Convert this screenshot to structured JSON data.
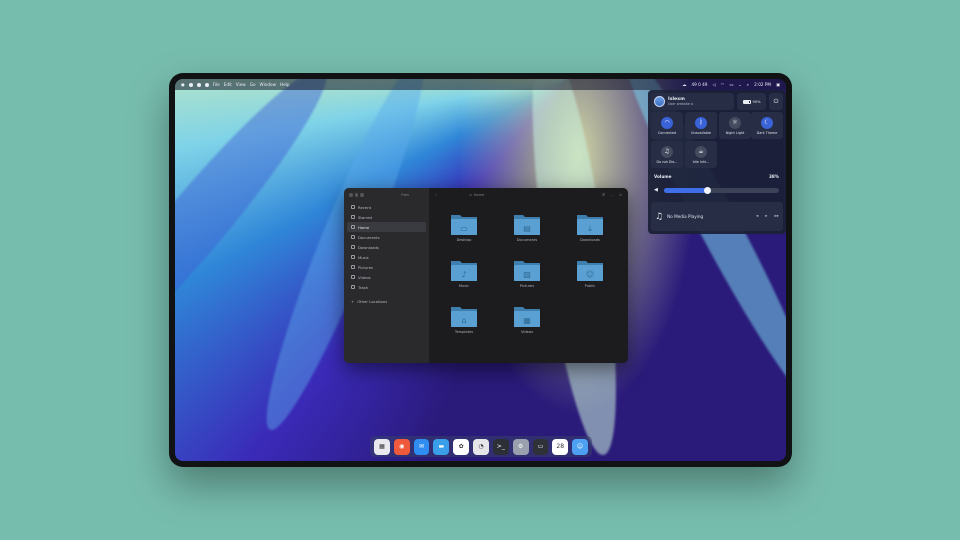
{
  "menubar": {
    "apple_icon": "apple-icon",
    "menus": [
      "File",
      "Edit",
      "View",
      "Go",
      "Window",
      "Help"
    ],
    "clock": "2:02 PM",
    "status_text": "49 0 49"
  },
  "file_manager": {
    "sidebar_title": "Files",
    "path_label": "Home",
    "sidebar_items": [
      {
        "label": "Recent",
        "icon": "clock-icon"
      },
      {
        "label": "Starred",
        "icon": "star-icon"
      },
      {
        "label": "Home",
        "icon": "home-icon"
      },
      {
        "label": "Documents",
        "icon": "document-icon"
      },
      {
        "label": "Downloads",
        "icon": "download-icon"
      },
      {
        "label": "Music",
        "icon": "music-icon"
      },
      {
        "label": "Pictures",
        "icon": "picture-icon"
      },
      {
        "label": "Videos",
        "icon": "video-icon"
      },
      {
        "label": "Trash",
        "icon": "trash-icon"
      }
    ],
    "other_locations": "Other Locations",
    "folders": [
      {
        "label": "Desktop",
        "icon": "desktop-icon"
      },
      {
        "label": "Documents",
        "icon": "document-icon"
      },
      {
        "label": "Downloads",
        "icon": "download-icon"
      },
      {
        "label": "Music",
        "icon": "music-icon"
      },
      {
        "label": "Pictures",
        "icon": "picture-icon"
      },
      {
        "label": "Public",
        "icon": "people-icon"
      },
      {
        "label": "Templates",
        "icon": "template-icon"
      },
      {
        "label": "Videos",
        "icon": "film-icon"
      }
    ]
  },
  "quick_settings": {
    "user_name": "Islexm",
    "user_sub": "User website a",
    "battery": "90%",
    "tiles": [
      {
        "label": "Connected",
        "icon": "wifi-icon",
        "active": true
      },
      {
        "label": "Unavailable",
        "icon": "bluetooth-icon",
        "active": true
      },
      {
        "label": "Night Light",
        "icon": "night-light-icon",
        "active": false
      },
      {
        "label": "Dark Theme",
        "icon": "dark-theme-icon",
        "active": true
      },
      {
        "label": "Do not Dis...",
        "icon": "dnd-icon",
        "active": false
      },
      {
        "label": "Idle Inhi...",
        "icon": "idle-inhibit-icon",
        "active": false
      }
    ],
    "volume_title": "Volume",
    "volume_pct": "38%",
    "volume_value": 0.38,
    "media_label": "No Media Playing"
  },
  "dock": {
    "apps": [
      {
        "name": "launchpad-icon",
        "color": "#e8e8ee"
      },
      {
        "name": "browser-icon",
        "color": "#f05a3c"
      },
      {
        "name": "mail-icon",
        "color": "#2f8cf0"
      },
      {
        "name": "files-icon",
        "color": "#3a9ee8"
      },
      {
        "name": "photos-icon",
        "color": "#ffffff"
      },
      {
        "name": "disk-icon",
        "color": "#e6e6ea"
      },
      {
        "name": "terminal-icon",
        "color": "#2c2f36"
      },
      {
        "name": "settings-icon",
        "color": "#9aa0ad"
      },
      {
        "name": "monitor-icon",
        "color": "#2e3138"
      },
      {
        "name": "calendar-icon",
        "color": "#ffffff"
      },
      {
        "name": "finder-icon",
        "color": "#4ea0f2"
      }
    ]
  }
}
